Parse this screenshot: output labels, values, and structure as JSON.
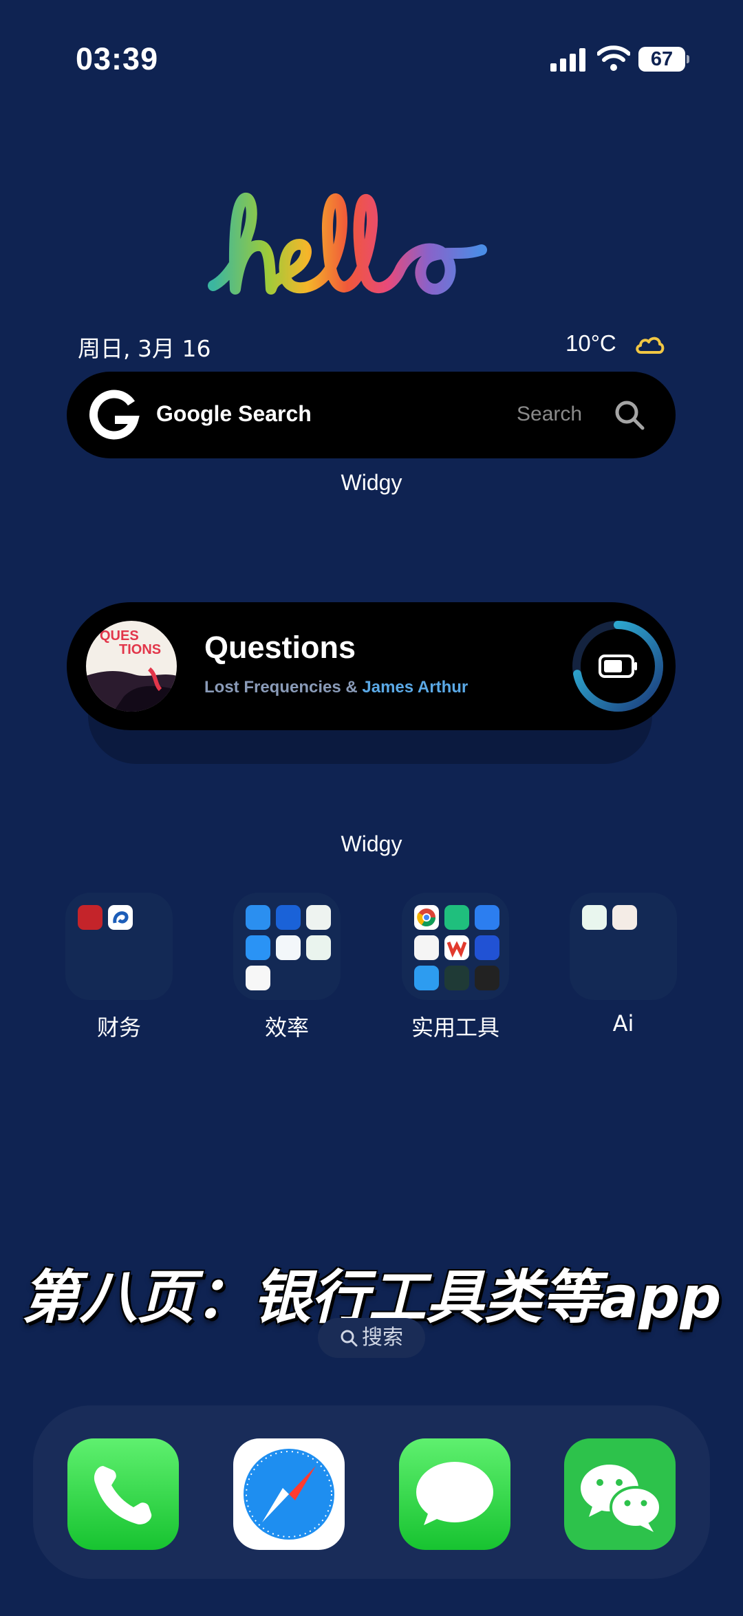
{
  "status_bar": {
    "time": "03:39",
    "battery": "67"
  },
  "header": {
    "date": "周日, 3月 16",
    "temperature": "10°C",
    "weather_icon": "cloud-icon"
  },
  "google_widget": {
    "title": "Google Search",
    "search_label": "Search"
  },
  "widget_labels": [
    "Widgy",
    "Widgy"
  ],
  "music_widget": {
    "title": "Questions",
    "artist_part1": "Lost Frequencies & ",
    "artist_part2": "James Arthur",
    "album_text_line1": "QUES",
    "album_text_line2": "TIONS",
    "progress_fraction": 0.72
  },
  "folders": [
    {
      "label": "财务"
    },
    {
      "label": "效率"
    },
    {
      "label": "实用工具"
    },
    {
      "label": "Ai"
    }
  ],
  "banner": "第八页：银行工具类等app",
  "search_pill": "搜索",
  "dock": [
    "phone-icon",
    "safari-icon",
    "messages-icon",
    "wechat-icon"
  ],
  "colors": {
    "background": "#0f2352",
    "accent_blue": "#5ba9e6",
    "cloud_yellow": "#f2c744"
  }
}
